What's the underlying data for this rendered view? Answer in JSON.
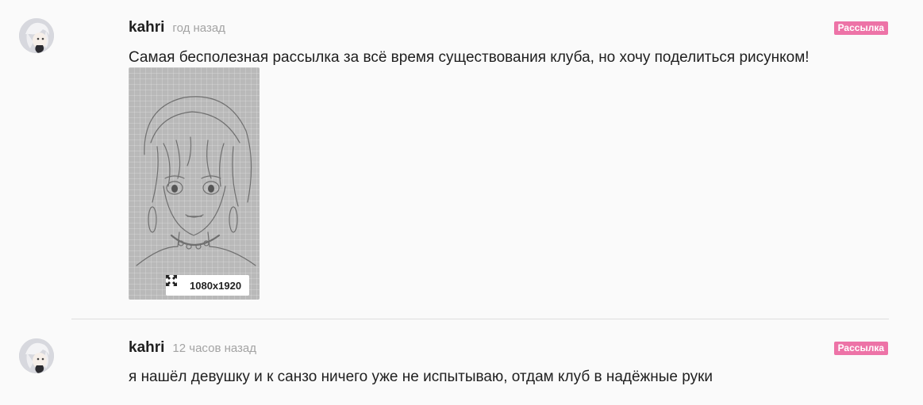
{
  "posts": [
    {
      "author": "kahri",
      "time": "год назад",
      "tag": "Рассылка",
      "text": "Самая бесполезная рассылка за всё время существования клуба, но хочу поделиться рисунком!",
      "attachment": {
        "size_label": "1080x1920",
        "icon": "expand-icon"
      },
      "avatar_icon": "avatar"
    },
    {
      "author": "kahri",
      "time": "12 часов назад",
      "tag": "Рассылка",
      "text": "я нашёл девушку и к санзо ничего уже не испытываю, отдам клуб в надёжные руки",
      "avatar_icon": "avatar"
    }
  ],
  "colors": {
    "tag_bg": "#ed73a7",
    "meta_text": "#a3a3a3",
    "divider": "#dedede",
    "background": "#fafafa"
  }
}
